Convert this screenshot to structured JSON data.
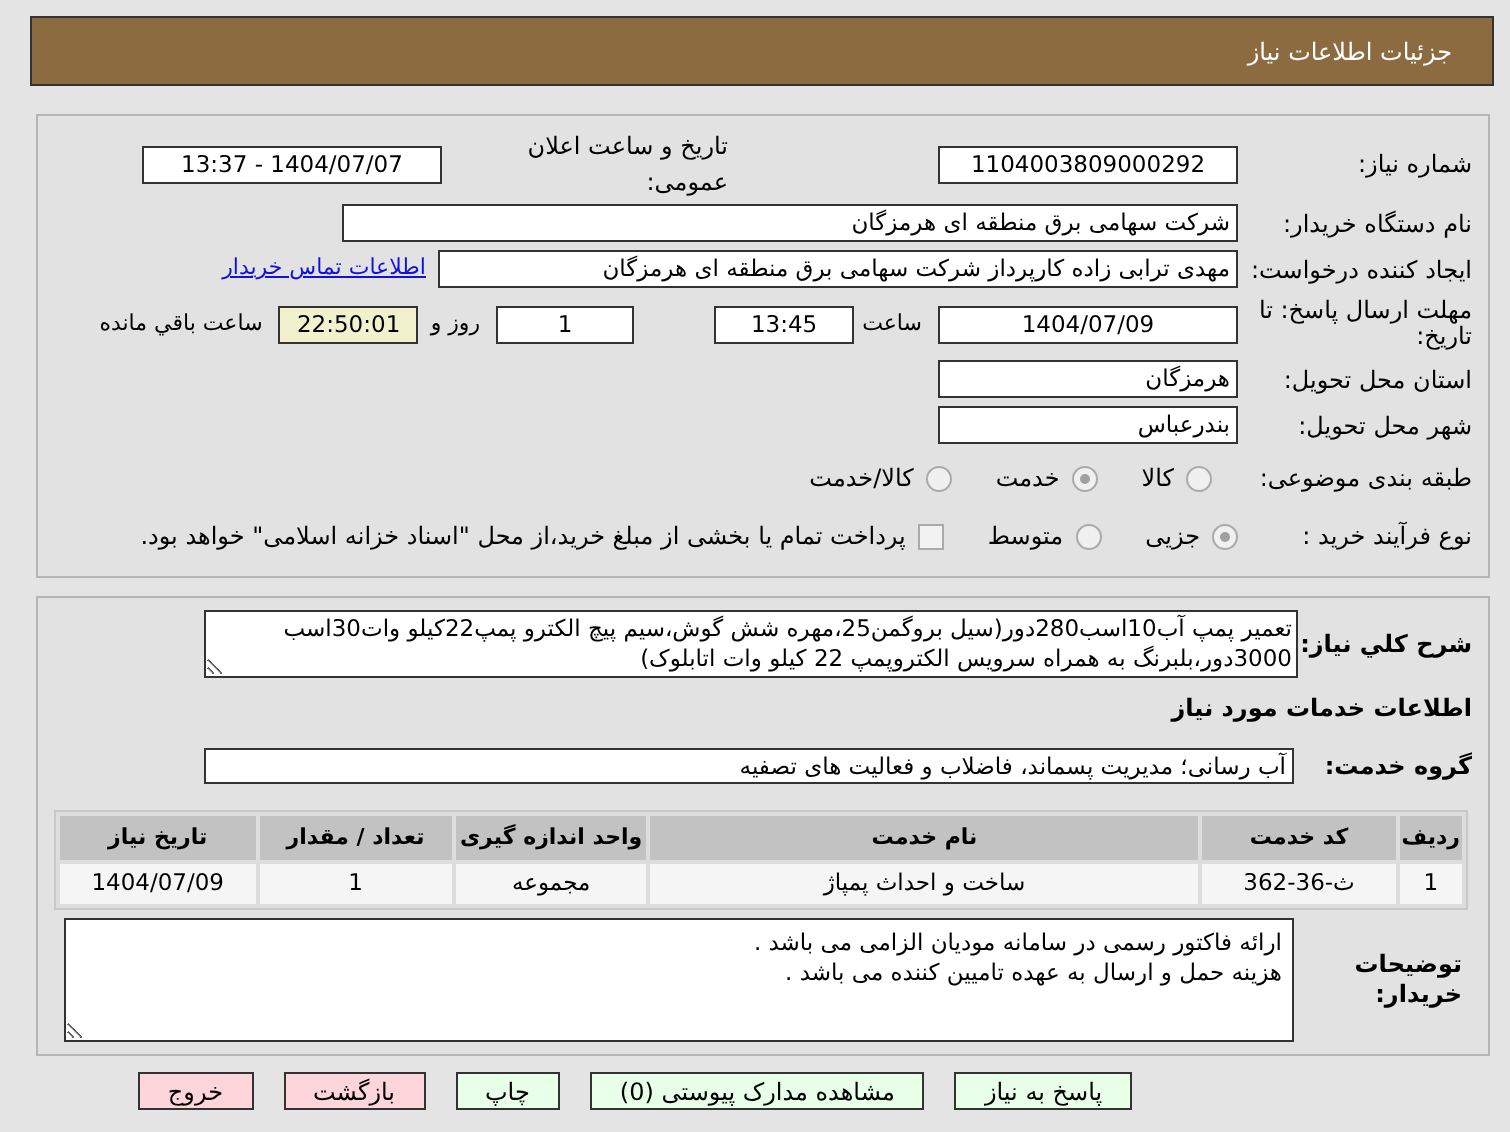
{
  "header": {
    "title": "جزئیات اطلاعات نیاز"
  },
  "need_number": {
    "label": "شماره نیاز:",
    "value": "1104003809000292"
  },
  "announce": {
    "label": "تاریخ و ساعت اعلان عمومی:",
    "value": "1404/07/07 - 13:37"
  },
  "buyer_org": {
    "label": "نام دستگاه خریدار:",
    "value": "شرکت سهامی برق منطقه ای هرمزگان"
  },
  "requester": {
    "label": "ایجاد کننده درخواست:",
    "value": "مهدی ترابی زاده کارپرداز شرکت سهامی برق منطقه ای هرمزگان",
    "link": "اطلاعات تماس خریدار"
  },
  "deadline": {
    "label": "مهلت ارسال پاسخ: تا تاریخ:",
    "date": "1404/07/09",
    "time_label": "ساعت",
    "time": "13:45",
    "days": "1",
    "days_label": "روز و",
    "remaining": "22:50:01",
    "remaining_label": "ساعت باقي مانده"
  },
  "province": {
    "label": "استان محل تحویل:",
    "value": "هرمزگان"
  },
  "city": {
    "label": "شهر محل تحویل:",
    "value": "بندرعباس"
  },
  "category": {
    "label": "طبقه بندی موضوعی:",
    "options": [
      {
        "label": "کالا",
        "selected": false
      },
      {
        "label": "خدمت",
        "selected": true
      },
      {
        "label": "کالا/خدمت",
        "selected": false
      }
    ]
  },
  "process": {
    "label": "نوع فرآیند خرید :",
    "options": [
      {
        "label": "جزیی",
        "selected": true
      },
      {
        "label": "متوسط",
        "selected": false
      }
    ],
    "checkbox": {
      "label": "پرداخت تمام یا بخشی از مبلغ خرید،از محل \"اسناد خزانه اسلامی\" خواهد بود.",
      "checked": false
    }
  },
  "description": {
    "label": "شرح کلي نياز:",
    "lines": [
      "تعمیر پمپ آب10اسب280دور(سیل بروگمن25،مهره شش گوش،سیم پیچ الکترو پمپ22کیلو وات30اسب",
      "3000دور،بلبرنگ به همراه سرویس الکتروپمپ 22 کیلو وات اتابلوک)"
    ]
  },
  "services_heading": "اطلاعات خدمات مورد نیاز",
  "service_group": {
    "label": "گروه خدمت:",
    "value": "آب رسانی؛ مدیریت پسماند، فاضلاب و فعالیت های تصفیه"
  },
  "table": {
    "columns": [
      "ردیف",
      "کد خدمت",
      "نام خدمت",
      "واحد اندازه گیری",
      "تعداد / مقدار",
      "تاریخ نیاز"
    ],
    "rows": [
      [
        "1",
        "ث-36-362",
        "ساخت و احداث پمپاژ",
        "مجموعه",
        "1",
        "1404/07/09"
      ]
    ]
  },
  "notes": {
    "label": "توضیحات خریدار:",
    "lines": [
      "ارائه فاکتور رسمی در سامانه مودیان الزامی می باشد .",
      "هزینه حمل و ارسال به عهده تامیین کننده می باشد ."
    ]
  },
  "buttons": [
    {
      "label": "پاسخ به نیاز",
      "kind": "action"
    },
    {
      "label": "مشاهده مدارک پیوستی (0)",
      "kind": "action"
    },
    {
      "label": "چاپ",
      "kind": "action"
    },
    {
      "label": "بازگشت",
      "kind": "exit"
    },
    {
      "label": "خروج",
      "kind": "exit"
    }
  ]
}
